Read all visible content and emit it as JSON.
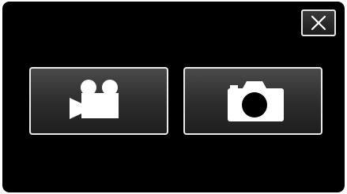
{
  "screen": {
    "close_button": {
      "icon": "close-icon"
    },
    "modes": [
      {
        "id": "video",
        "icon": "video-camera-icon"
      },
      {
        "id": "still",
        "icon": "still-camera-icon"
      }
    ],
    "colors": {
      "background": "#000000",
      "button_border": "#eaeaea",
      "icon": "#ffffff"
    }
  }
}
